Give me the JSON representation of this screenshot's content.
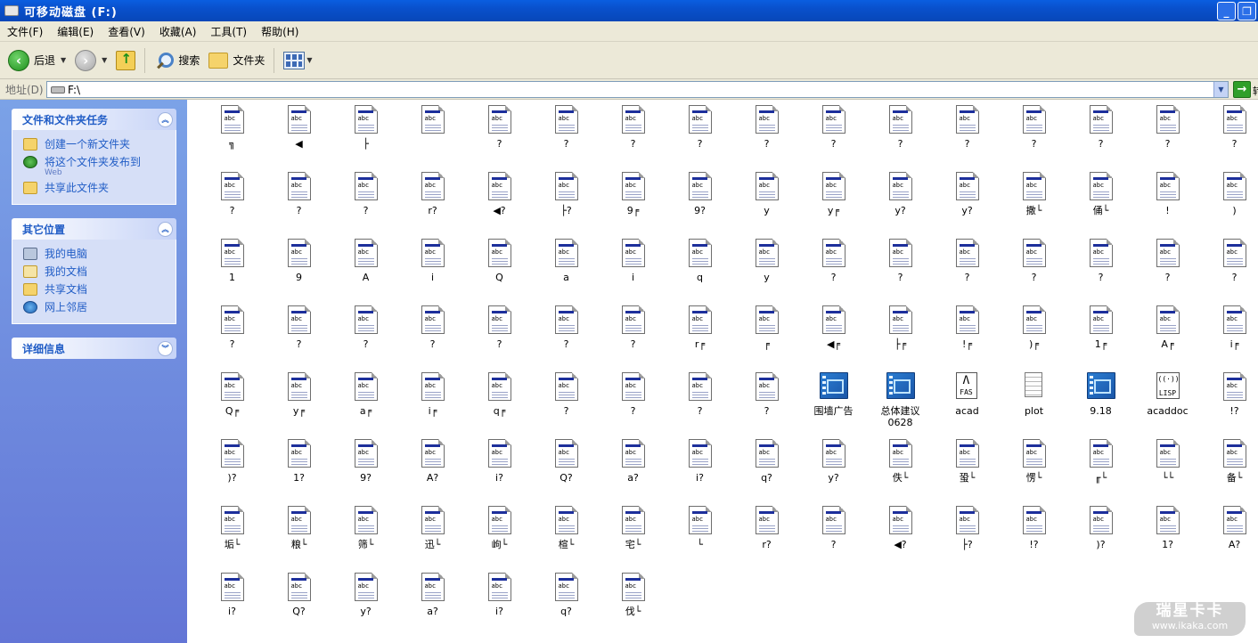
{
  "window": {
    "title": "可移动磁盘 (F:)"
  },
  "menu": [
    "文件(F)",
    "编辑(E)",
    "查看(V)",
    "收藏(A)",
    "工具(T)",
    "帮助(H)"
  ],
  "toolbar": {
    "back": "后退",
    "search": "搜索",
    "folders": "文件夹"
  },
  "address": {
    "label": "地址(D)",
    "value": "F:\\",
    "go": "转"
  },
  "left_panels": {
    "tasks": {
      "title": "文件和文件夹任务",
      "items": [
        {
          "label": "创建一个新文件夹",
          "icon": "new-folder-icon"
        },
        {
          "label": "将这个文件夹发布到",
          "sub": "Web",
          "icon": "publish-web-icon"
        },
        {
          "label": "共享此文件夹",
          "icon": "share-folder-icon"
        }
      ]
    },
    "places": {
      "title": "其它位置",
      "items": [
        {
          "label": "我的电脑",
          "icon": "my-computer-icon"
        },
        {
          "label": "我的文档",
          "icon": "my-documents-icon"
        },
        {
          "label": "共享文档",
          "icon": "shared-documents-icon"
        },
        {
          "label": "网上邻居",
          "icon": "network-places-icon"
        }
      ]
    },
    "details": {
      "title": "详细信息"
    }
  },
  "files": [
    [
      {
        "l": "╗"
      },
      {
        "l": "◀"
      },
      {
        "l": "├"
      },
      {
        "l": ""
      },
      {
        "l": "?"
      },
      {
        "l": "?"
      },
      {
        "l": "?"
      },
      {
        "l": "?"
      },
      {
        "l": "?"
      },
      {
        "l": "?"
      },
      {
        "l": "?"
      },
      {
        "l": "?"
      },
      {
        "l": "?"
      },
      {
        "l": "?"
      },
      {
        "l": "?"
      },
      {
        "l": "?"
      }
    ],
    [
      {
        "l": "?"
      },
      {
        "l": "?"
      },
      {
        "l": "?"
      },
      {
        "l": "r?"
      },
      {
        "l": "◀?"
      },
      {
        "l": "├?"
      },
      {
        "l": "9╒"
      },
      {
        "l": "9?"
      },
      {
        "l": "y"
      },
      {
        "l": "y╒"
      },
      {
        "l": "y?"
      },
      {
        "l": "y?"
      },
      {
        "l": "撒└"
      },
      {
        "l": "俑└"
      },
      {
        "l": "!"
      },
      {
        "l": ")"
      }
    ],
    [
      {
        "l": "1"
      },
      {
        "l": "9"
      },
      {
        "l": "A"
      },
      {
        "l": "i"
      },
      {
        "l": "Q"
      },
      {
        "l": "a"
      },
      {
        "l": "i"
      },
      {
        "l": "q"
      },
      {
        "l": "y"
      },
      {
        "l": "?"
      },
      {
        "l": "?"
      },
      {
        "l": "?"
      },
      {
        "l": "?"
      },
      {
        "l": "?"
      },
      {
        "l": "?"
      },
      {
        "l": "?"
      }
    ],
    [
      {
        "l": "?"
      },
      {
        "l": "?"
      },
      {
        "l": "?"
      },
      {
        "l": "?"
      },
      {
        "l": "?"
      },
      {
        "l": "?"
      },
      {
        "l": "?"
      },
      {
        "l": "r╒"
      },
      {
        "l": "╒"
      },
      {
        "l": "◀╒"
      },
      {
        "l": "├╒"
      },
      {
        "l": "!╒"
      },
      {
        "l": ")╒"
      },
      {
        "l": "1╒"
      },
      {
        "l": "A╒"
      },
      {
        "l": "i╒"
      }
    ],
    [
      {
        "l": "Q╒"
      },
      {
        "l": "y╒"
      },
      {
        "l": "a╒"
      },
      {
        "l": "i╒"
      },
      {
        "l": "q╒"
      },
      {
        "l": "?"
      },
      {
        "l": "?"
      },
      {
        "l": "?"
      },
      {
        "l": "?"
      },
      {
        "l": "围墙广告",
        "t": "dwg"
      },
      {
        "l": "总体建议\n0628",
        "t": "dwg"
      },
      {
        "l": "acad",
        "t": "fas"
      },
      {
        "l": "plot",
        "t": "notes"
      },
      {
        "l": "9.18",
        "t": "dwg"
      },
      {
        "l": "acaddoc",
        "t": "lsp"
      },
      {
        "l": "!?"
      }
    ],
    [
      {
        "l": ")?"
      },
      {
        "l": "1?"
      },
      {
        "l": "9?"
      },
      {
        "l": "A?"
      },
      {
        "l": "i?"
      },
      {
        "l": "Q?"
      },
      {
        "l": "a?"
      },
      {
        "l": "i?"
      },
      {
        "l": "q?"
      },
      {
        "l": "y?"
      },
      {
        "l": "佚└"
      },
      {
        "l": "蛩└"
      },
      {
        "l": "愣└"
      },
      {
        "l": "╓└"
      },
      {
        "l": "└└"
      },
      {
        "l": "备└"
      }
    ],
    [
      {
        "l": "垢└"
      },
      {
        "l": "粮└"
      },
      {
        "l": "筛└"
      },
      {
        "l": "迅└"
      },
      {
        "l": "岣└"
      },
      {
        "l": "楦└"
      },
      {
        "l": "宅└"
      },
      {
        "l": "└"
      },
      {
        "l": "r?"
      },
      {
        "l": "?"
      },
      {
        "l": "◀?"
      },
      {
        "l": "├?"
      },
      {
        "l": "!?"
      },
      {
        "l": ")?"
      },
      {
        "l": "1?"
      },
      {
        "l": "A?"
      }
    ],
    [
      {
        "l": "i?"
      },
      {
        "l": "Q?"
      },
      {
        "l": "y?"
      },
      {
        "l": "a?"
      },
      {
        "l": "i?"
      },
      {
        "l": "q?"
      },
      {
        "l": "伐└"
      }
    ]
  ],
  "watermark": {
    "line1": "瑞星卡卡",
    "line2": "www.ikaka.com"
  }
}
